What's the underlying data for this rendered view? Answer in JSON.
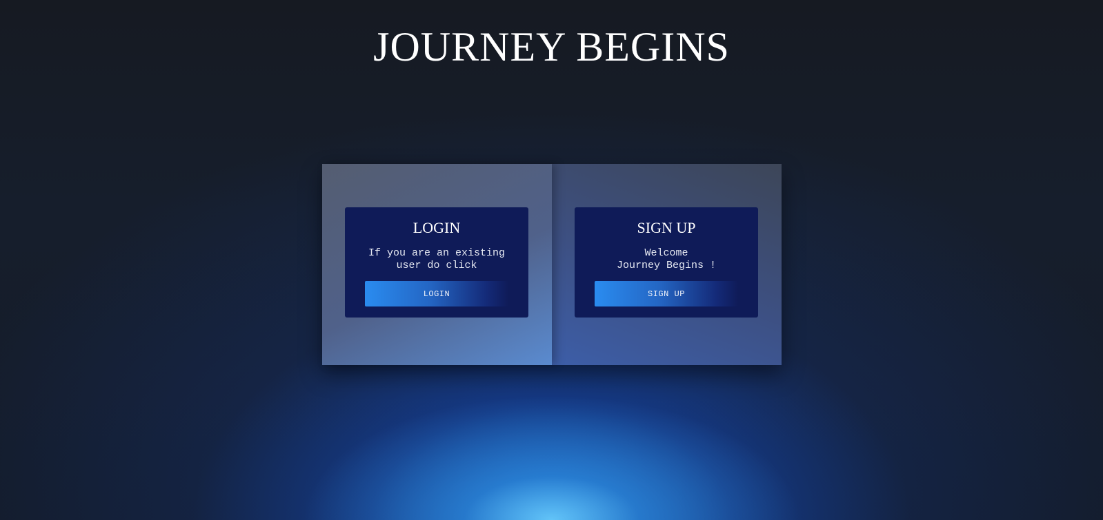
{
  "page": {
    "title": "JOURNEY BEGINS"
  },
  "login_card": {
    "title": "LOGIN",
    "text": "If you are an existing\nuser do click",
    "button_label": "LOGIN"
  },
  "signup_card": {
    "title": "SIGN UP",
    "text": "Welcome\nJourney Begins !",
    "button_label": "SIGN UP"
  },
  "colors": {
    "card_background": "#0f1b58",
    "button_gradient_start": "#2a8cf0",
    "title_text": "#ffffff",
    "glow": "#2a9ae0"
  }
}
